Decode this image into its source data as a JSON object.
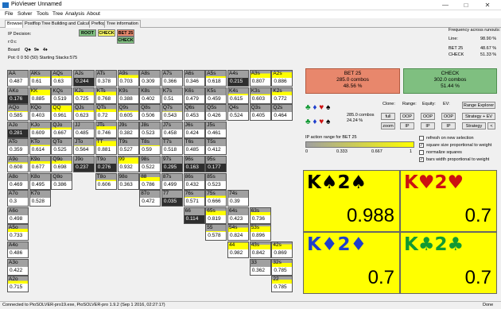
{
  "window": {
    "title": "PioViewer Unnamed"
  },
  "menu": [
    "File",
    "Solver",
    "Tools",
    "Tree",
    "Analysis",
    "About"
  ],
  "tabs": [
    "Browser",
    "Postflop Tree Building and Calculations",
    "Preflop",
    "Tree information"
  ],
  "tree": {
    "root": "ROOT",
    "check": "CHECK",
    "bet": "BET 25",
    "check2": "CHECK"
  },
  "info": {
    "ip_decision": "IP Decision:",
    "rd": "r:0:c",
    "board_label": "Board",
    "board": [
      "Q♣",
      "9♠",
      "4♦"
    ],
    "pot": "Pot: 0 0 50 (50) Starting Stacks:575"
  },
  "freq": {
    "title": "Frequency across runouts:",
    "line_label": "Line:",
    "line_val": "98.90 %",
    "bet_label": "BET 25",
    "bet_val": "48.67 %",
    "chk_label": "CHECK",
    "chk_val": "51.33 %"
  },
  "grid": [
    [
      "AA",
      "0.487"
    ],
    [
      "AKs",
      "0.61"
    ],
    [
      "AQs",
      "0.63"
    ],
    [
      "AJs",
      "0.244"
    ],
    [
      "ATs",
      "0.378"
    ],
    [
      "A9s",
      "0.703"
    ],
    [
      "A8s",
      "0.309"
    ],
    [
      "A7s",
      "0.366"
    ],
    [
      "A6s",
      "0.346"
    ],
    [
      "A5s",
      "0.618"
    ],
    [
      "A4s",
      "0.215"
    ],
    [
      "A3s",
      "0.807"
    ],
    [
      "A2s",
      "0.886"
    ],
    [
      "AKo",
      "0.176"
    ],
    [
      "KK",
      "0.885"
    ],
    [
      "KQs",
      "0.519"
    ],
    [
      "KJs",
      "0.725"
    ],
    [
      "KTs",
      "0.768"
    ],
    [
      "K9s",
      "0.388"
    ],
    [
      "K8s",
      "0.402"
    ],
    [
      "K7s",
      "0.51"
    ],
    [
      "K6s",
      "0.479"
    ],
    [
      "K5s",
      "0.459"
    ],
    [
      "K4s",
      "0.615"
    ],
    [
      "K3s",
      "0.603"
    ],
    [
      "K2s",
      "0.772"
    ],
    [
      "AQo",
      "0.585"
    ],
    [
      "KQo",
      "0.403"
    ],
    [
      "QQ",
      "0.961"
    ],
    [
      "QJs",
      "0.623"
    ],
    [
      "QTs",
      "0.72"
    ],
    [
      "Q9s",
      "0.605"
    ],
    [
      "Q8s",
      "0.506"
    ],
    [
      "Q7s",
      "0.543"
    ],
    [
      "Q6s",
      "0.453"
    ],
    [
      "Q5s",
      "0.426"
    ],
    [
      "Q4s",
      "0.524"
    ],
    [
      "Q3s",
      "0.405"
    ],
    [
      "Q2s",
      "0.464"
    ],
    [
      "AJo",
      "0.281"
    ],
    [
      "KJo",
      "0.609"
    ],
    [
      "QJo",
      "0.667"
    ],
    [
      "JJ",
      "0.485"
    ],
    [
      "JTs",
      "0.746"
    ],
    [
      "J9s",
      "0.382"
    ],
    [
      "J8s",
      "0.523"
    ],
    [
      "J7s",
      "0.458"
    ],
    [
      "J6s",
      "0.424"
    ],
    [
      "J5s",
      "0.461"
    ],
    null,
    null,
    null,
    [
      "ATo",
      "0.359"
    ],
    [
      "KTo",
      "0.614"
    ],
    [
      "QTo",
      "0.525"
    ],
    [
      "JTo",
      "0.564"
    ],
    [
      "TT",
      "0.881"
    ],
    [
      "T9s",
      "0.527"
    ],
    [
      "T8s",
      "0.59"
    ],
    [
      "T7s",
      "0.518"
    ],
    [
      "T6s",
      "0.485"
    ],
    [
      "T5s",
      "0.412"
    ],
    null,
    null,
    null,
    [
      "A9o",
      "0.608"
    ],
    [
      "K9o",
      "0.677"
    ],
    [
      "Q9o",
      "0.698"
    ],
    [
      "J9o",
      "0.237"
    ],
    [
      "T9o",
      "0.276"
    ],
    [
      "99",
      "0.932"
    ],
    [
      "98s",
      "0.522"
    ],
    [
      "97s",
      "0.295"
    ],
    [
      "96s",
      "0.163"
    ],
    [
      "95s",
      "0.177"
    ],
    null,
    null,
    null,
    [
      "A8o",
      "0.469"
    ],
    [
      "K8o",
      "0.495"
    ],
    [
      "Q8o",
      "0.386"
    ],
    null,
    [
      "T8o",
      "0.606"
    ],
    [
      "98o",
      "0.363"
    ],
    [
      "88",
      "0.786"
    ],
    [
      "87s",
      "0.499"
    ],
    [
      "86s",
      "0.432"
    ],
    [
      "85s",
      "0.523"
    ],
    null,
    null,
    null,
    [
      "A7o",
      "0.3"
    ],
    [
      "K7o",
      "0.528"
    ],
    null,
    null,
    null,
    null,
    [
      "87o",
      "0.472"
    ],
    [
      "77",
      "0.035"
    ],
    [
      "76s",
      "0.571"
    ],
    [
      "75s",
      "0.666"
    ],
    [
      "74s",
      "0.39"
    ],
    null,
    null,
    [
      "A6o",
      "0.498"
    ],
    null,
    null,
    null,
    null,
    null,
    null,
    null,
    [
      "66",
      "0.114"
    ],
    [
      "65s",
      "0.819"
    ],
    [
      "64s",
      "0.423"
    ],
    [
      "63s",
      "0.736"
    ],
    null,
    [
      "A5o",
      "0.733"
    ],
    null,
    null,
    null,
    null,
    null,
    null,
    null,
    null,
    [
      "55",
      "0.578"
    ],
    [
      "54s",
      "0.824"
    ],
    [
      "53s",
      "0.896"
    ],
    null,
    [
      "A4o",
      "0.486"
    ],
    null,
    null,
    null,
    null,
    null,
    null,
    null,
    null,
    null,
    [
      "44",
      "0.982"
    ],
    [
      "43s",
      "0.842"
    ],
    [
      "42s",
      "0.869"
    ],
    [
      "A3o",
      "0.422"
    ],
    null,
    null,
    null,
    null,
    null,
    null,
    null,
    null,
    null,
    null,
    [
      "33",
      "0.362"
    ],
    [
      "32s",
      "0.785"
    ],
    [
      "A2o",
      "0.715"
    ],
    null,
    null,
    null,
    null,
    null,
    null,
    null,
    null,
    null,
    null,
    null,
    [
      "22",
      "0.785"
    ]
  ],
  "bet": {
    "title": "BET 25",
    "combos": "285.0 combos",
    "pct": "48.56 %"
  },
  "chk": {
    "title": "CHECK",
    "combos": "302.0 combos",
    "pct": "51.44 %"
  },
  "suits": {
    "combos": "285.0 combos",
    "pct": "24.24 %"
  },
  "controls": {
    "clone": "Clone:",
    "range": "Range:",
    "equity": "Equity:",
    "ev": "EV:",
    "full": "full",
    "zoom": "zoom",
    "oop": "OOP",
    "ip": "IP",
    "range_explorer": "Range Explorer",
    "strategy_ev": "Strategy + EV",
    "strategy": "Strategy"
  },
  "legend": {
    "title": "IP action range for BET 25",
    "t0": "0",
    "t1": "0.333",
    "t2": "0.667",
    "t3": "1"
  },
  "options": [
    {
      "label": "refresh on new selection",
      "checked": false
    },
    {
      "label": "square size proportional to weight",
      "checked": true
    },
    {
      "label": "normalize squares",
      "checked": false
    },
    {
      "label": "bars width proportional to weight",
      "checked": true
    }
  ],
  "cards": [
    {
      "title": "K♠2♠",
      "value": "0.988",
      "color": "#000000"
    },
    {
      "title": "K♥2♥",
      "value": "0.7",
      "color": "#cc1111"
    },
    {
      "title": "K♦2♦",
      "value": "0.7",
      "color": "#1f3fcc"
    },
    {
      "title": "K♣2♣",
      "value": "0.7",
      "color": "#119933"
    }
  ],
  "status": {
    "text": "Connected to PioSOLVER-pro19.exe, PioSOLVER-pro 1.9.2 (Sep  1 2016, 02:27:17)",
    "done": "Done"
  }
}
